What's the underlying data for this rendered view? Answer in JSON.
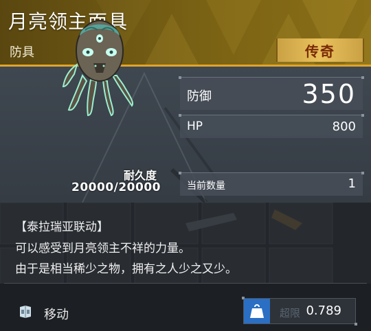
{
  "item": {
    "name": "月亮领主面具",
    "type": "防具",
    "rarity": "传奇"
  },
  "durability": {
    "label": "耐久度",
    "value": "20000/20000"
  },
  "stats": {
    "defense": {
      "label": "防御",
      "value": "350"
    },
    "hp": {
      "label": "HP",
      "value": "800"
    },
    "quantity": {
      "label": "当前数量",
      "value": "1"
    }
  },
  "description": {
    "line1": "【泰拉瑞亚联动】",
    "line2": "可以感受到月亮领主不祥的力量。",
    "line3": "由于是相当稀少之物，拥有之人少之又少。"
  },
  "footer": {
    "move_label": "移动",
    "overload_label": "超限",
    "weight_value": "0.789"
  },
  "icons": {
    "item": "moon-lord-mask-icon",
    "move": "move-crate-icon",
    "weight": "weight-bag-icon"
  },
  "colors": {
    "header": "#7a6214",
    "accent": "#e0a42a",
    "rarity_bg": "#e9c15c",
    "rarity_text": "#7a2a06",
    "weight_icon_bg": "#2a6fc4"
  }
}
